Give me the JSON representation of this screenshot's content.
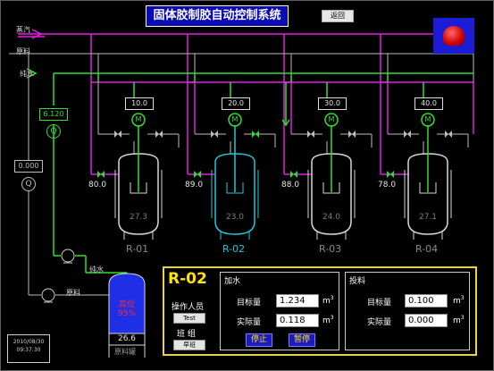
{
  "header": {
    "title": "固体胶制胶自动控制系统",
    "back_label": "返回"
  },
  "pipes": {
    "steam_label": "蒸汽",
    "material_label": "原料",
    "water_label": "纯水"
  },
  "flow": {
    "water_flow": "6.120",
    "material_flow": "0.000",
    "flow_symbol": "Q"
  },
  "pumps": {
    "water_label": "纯水",
    "material_label": "原料"
  },
  "tank": {
    "alarm_text_1": "高位",
    "alarm_text_2": "95%",
    "value": "26.6",
    "label": "原料罐"
  },
  "reactors": [
    {
      "name": "R-01",
      "speed": "10.0",
      "temp": "80.0",
      "level": "27.3",
      "name_color": "#8a8a8a"
    },
    {
      "name": "R-02",
      "speed": "20.0",
      "temp": "89.0",
      "level": "23.0",
      "name_color": "#21c8d8"
    },
    {
      "name": "R-03",
      "speed": "30.0",
      "temp": "88.0",
      "level": "24.0",
      "name_color": "#8a8a8a"
    },
    {
      "name": "R-04",
      "speed": "40.0",
      "temp": "78.0",
      "level": "27.1",
      "name_color": "#8a8a8a"
    }
  ],
  "motor_symbol": "M",
  "panel": {
    "reactor": "R-02",
    "operator_label": "操作人员",
    "operator_value": "Test",
    "shift_label": "班 组",
    "shift_value": "早班",
    "water_section": "加水",
    "feed_section": "投料",
    "target_label": "目标量",
    "actual_label": "实际量",
    "water_target": "1.234",
    "water_actual": "0.118",
    "feed_target": "0.100",
    "feed_actual": "0.000",
    "unit": "m",
    "unit_sup": "3",
    "stop_label": "停止",
    "pause_label": "暂停"
  },
  "clock": {
    "date": "2010/08/30",
    "time": "09:37:30"
  },
  "colors": {
    "steam": "#e020e0",
    "water": "#30e030",
    "material": "#bdbdbd",
    "panel_border": "#e8d24a",
    "title_bg": "#0b0bb4"
  }
}
